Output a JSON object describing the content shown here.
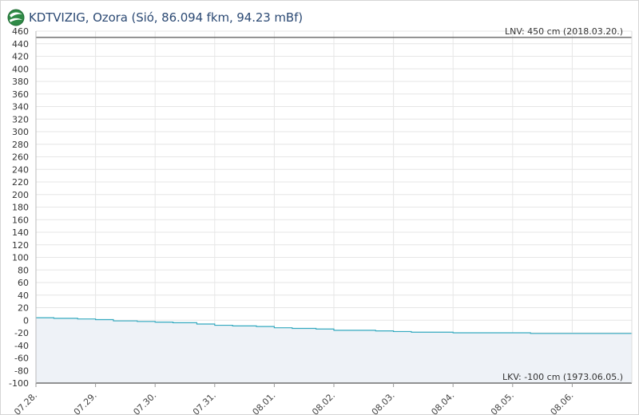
{
  "header": {
    "title": "KDTVIZIG, Ozora (Sió, 86.094 fkm, 94.23 mBf)",
    "logo_icon": "globe-logo-icon"
  },
  "colors": {
    "series": "#33a9bf",
    "area": "#eef2f7",
    "reference_line": "#555555",
    "grid": "#e6e6e6",
    "title": "#2c4a74"
  },
  "chart_data": {
    "type": "area",
    "title": "",
    "xlabel": "",
    "ylabel": "",
    "ylim": [
      -100,
      460
    ],
    "yticks": [
      460,
      440,
      420,
      400,
      380,
      360,
      340,
      320,
      300,
      280,
      260,
      240,
      220,
      200,
      180,
      160,
      140,
      120,
      100,
      80,
      60,
      40,
      20,
      0,
      -20,
      -40,
      -60,
      -80,
      -100
    ],
    "xlim": [
      0,
      10
    ],
    "x_ticks": [
      {
        "x": 0,
        "label": "07.28."
      },
      {
        "x": 1,
        "label": "07.29."
      },
      {
        "x": 2,
        "label": "07.30."
      },
      {
        "x": 3,
        "label": "07.31."
      },
      {
        "x": 4,
        "label": "08.01."
      },
      {
        "x": 5,
        "label": "08.02."
      },
      {
        "x": 6,
        "label": "08.03."
      },
      {
        "x": 7,
        "label": "08.04."
      },
      {
        "x": 8,
        "label": "08.05."
      },
      {
        "x": 9,
        "label": "08.06."
      }
    ],
    "grid": true,
    "series": [
      {
        "x": [
          0,
          0.3,
          0.7,
          1.0,
          1.3,
          1.7,
          2.0,
          2.3,
          2.7,
          3.0,
          3.3,
          3.7,
          4.0,
          4.3,
          4.7,
          5.0,
          5.3,
          5.7,
          6.0,
          6.3,
          6.7,
          7.0,
          7.3,
          7.7,
          8.0,
          8.3,
          8.7,
          9.0,
          9.5,
          10.0
        ],
        "values": [
          4,
          3,
          2,
          1,
          -1,
          -2,
          -3,
          -4,
          -6,
          -8,
          -9,
          -10,
          -12,
          -13,
          -14,
          -16,
          -16,
          -17,
          -18,
          -19,
          -19,
          -20,
          -20,
          -20,
          -20,
          -21,
          -21,
          -21,
          -21,
          -22
        ]
      }
    ],
    "reference_lines": [
      {
        "y": 450,
        "label": "LNV: 450 cm (2018.03.20.)",
        "position": "top-right"
      },
      {
        "y": -100,
        "label": "LKV: -100 cm (1973.06.05.)",
        "position": "bottom-right"
      }
    ]
  }
}
